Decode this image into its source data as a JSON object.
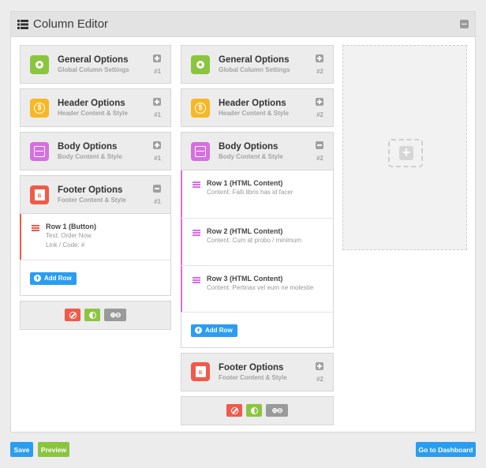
{
  "header": {
    "title": "Column Editor"
  },
  "columns": [
    {
      "cards": [
        {
          "title": "General Options",
          "subtitle": "Global Column Settings",
          "num": "#1",
          "color": "#8bc53f",
          "icon": "gear-icon"
        },
        {
          "title": "Header Options",
          "subtitle": "Header Content & Style",
          "num": "#1",
          "color": "#f6b826",
          "icon": "dollar-icon"
        },
        {
          "title": "Body Options",
          "subtitle": "Body Content & Style",
          "num": "#1",
          "color": "#d66fe0",
          "icon": "body-icon"
        },
        {
          "title": "Footer Options",
          "subtitle": "Footer Content & Style",
          "num": "#1",
          "color": "#f05a4a",
          "icon": "footer-icon"
        }
      ],
      "rows": [
        {
          "title": "Row 1 (Button)",
          "line1": "Text: Order Now",
          "line2": "Link / Code: #"
        }
      ],
      "add_row": "Add Row"
    },
    {
      "cards": [
        {
          "title": "General Options",
          "subtitle": "Global Column Settings",
          "num": "#2",
          "color": "#8bc53f",
          "icon": "gear-icon"
        },
        {
          "title": "Header Options",
          "subtitle": "Header Content & Style",
          "num": "#2",
          "color": "#f6b826",
          "icon": "dollar-icon"
        },
        {
          "title": "Body Options",
          "subtitle": "Body Content & Style",
          "num": "#2",
          "color": "#d66fe0",
          "icon": "body-icon"
        },
        {
          "title": "Footer Options",
          "subtitle": "Footer Content & Style",
          "num": "#2",
          "color": "#f05a4a",
          "icon": "footer-icon"
        }
      ],
      "rows": [
        {
          "title": "Row 1 (HTML Content)",
          "line1": "Content: Falli libris has id facer"
        },
        {
          "title": "Row 2 (HTML Content)",
          "line1": "Content: Cum at probo / minimum"
        },
        {
          "title": "Row 3 (HTML Content)",
          "line1": "Content: Pertinax vel eum ne molestie"
        }
      ],
      "add_row": "Add Row"
    }
  ],
  "buttons": {
    "save": "Save",
    "preview": "Preview",
    "dashboard": "Go to Dashboard"
  },
  "colors": {
    "blue": "#2b9df0",
    "green": "#8bc53f",
    "red": "#f05a4a",
    "purple": "#d66fe0",
    "yellow": "#f6b826"
  }
}
